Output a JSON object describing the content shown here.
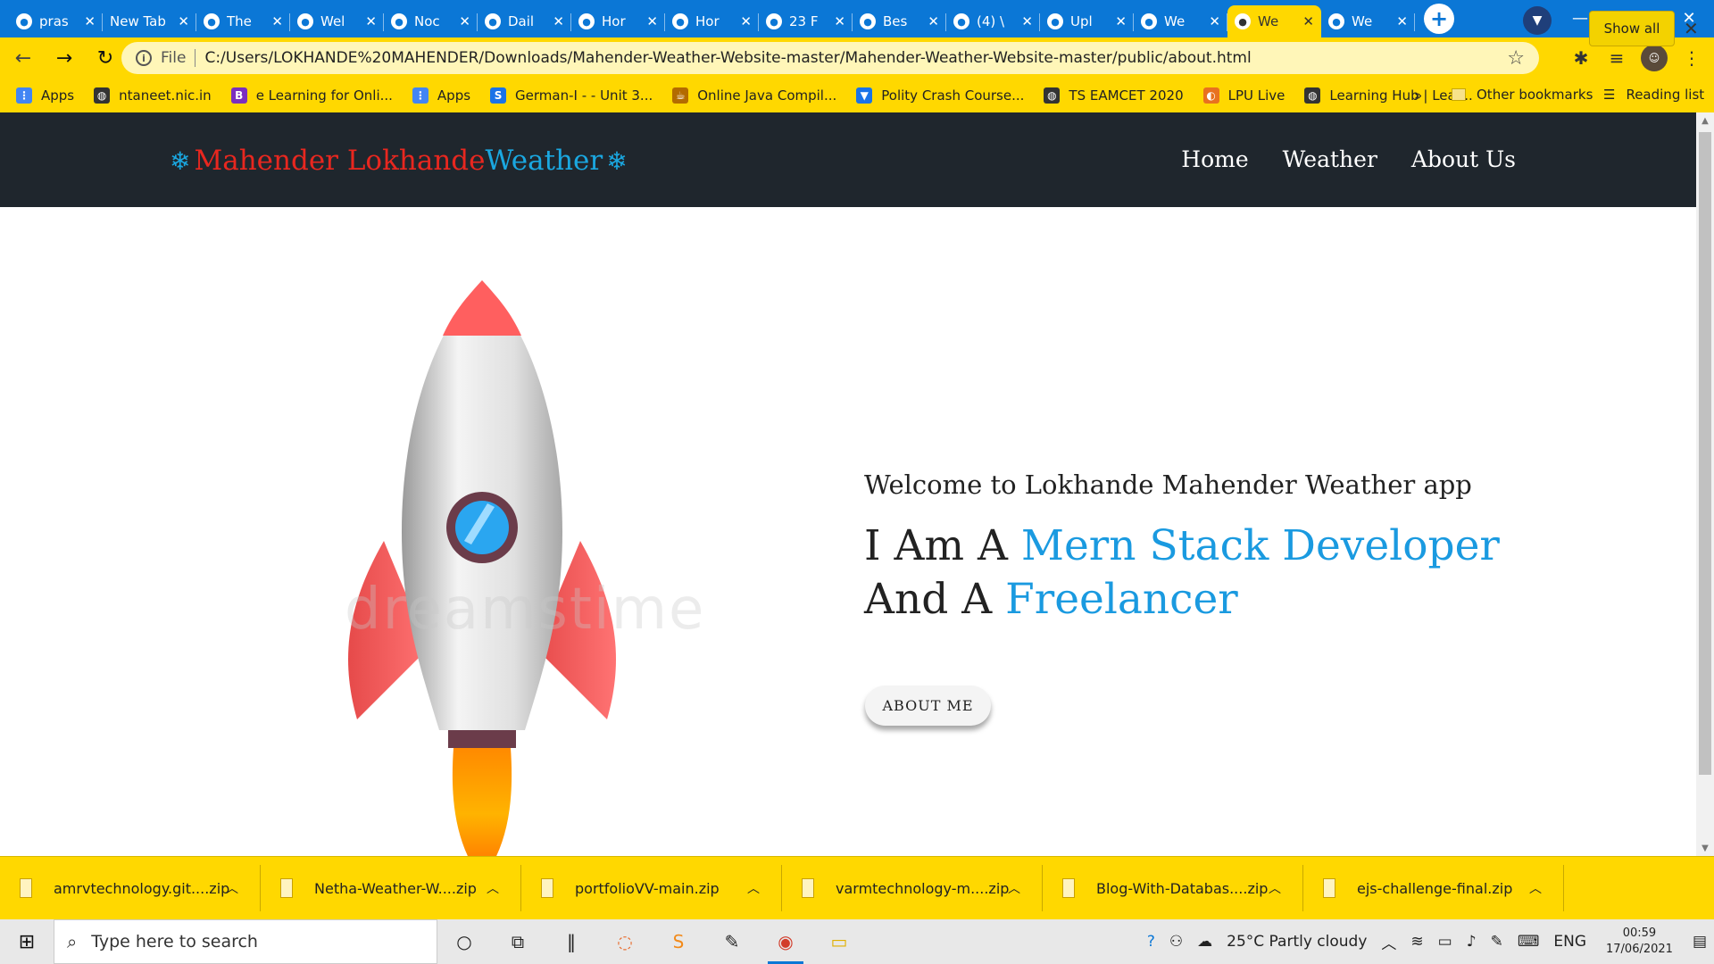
{
  "browser": {
    "tabs": [
      {
        "title": "pras",
        "icon": "github-icon"
      },
      {
        "title": "New Tab",
        "icon": ""
      },
      {
        "title": "The",
        "icon": "site-icon"
      },
      {
        "title": "Wel",
        "icon": "site-icon"
      },
      {
        "title": "Noc",
        "icon": "site-icon"
      },
      {
        "title": "Dail",
        "icon": "site-icon"
      },
      {
        "title": "Hor",
        "icon": "site-icon"
      },
      {
        "title": "Hor",
        "icon": "site-icon"
      },
      {
        "title": "23 F",
        "icon": "site-icon"
      },
      {
        "title": "Bes",
        "icon": "site-icon"
      },
      {
        "title": "(4) \\",
        "icon": "whatsapp-icon"
      },
      {
        "title": "Upl",
        "icon": "github-icon"
      },
      {
        "title": "We",
        "icon": "site-icon"
      },
      {
        "title": "We",
        "icon": "site-icon",
        "active": true
      },
      {
        "title": "We",
        "icon": "globe-icon"
      }
    ],
    "address": {
      "scheme": "File",
      "url": "C:/Users/LOKHANDE%20MAHENDER/Downloads/Mahender-Weather-Website-master/Mahender-Weather-Website-master/public/about.html"
    },
    "bookmarks": [
      {
        "label": "Apps",
        "icon": "apps-grid-icon"
      },
      {
        "label": "ntaneet.nic.in",
        "icon": "globe-icon"
      },
      {
        "label": "e Learning for Onli...",
        "icon": "bookmark-b-icon"
      },
      {
        "label": "Apps",
        "icon": "apps-grid-icon"
      },
      {
        "label": "German-I - - Unit 3...",
        "icon": "s-logo-icon"
      },
      {
        "label": "Online Java Compil...",
        "icon": "java-icon"
      },
      {
        "label": "Polity Crash Course...",
        "icon": "bookmark-icon"
      },
      {
        "label": "TS EAMCET 2020",
        "icon": "globe-icon"
      },
      {
        "label": "LPU Live",
        "icon": "lpu-icon"
      },
      {
        "label": "Learning Hub | Lear...",
        "icon": "globe-icon"
      }
    ],
    "bookmarks_more": "»",
    "other_bookmarks": "Other bookmarks",
    "reading_list": "Reading list"
  },
  "site": {
    "brand_part1": "Mahender Lokhande",
    "brand_part2": "Weather",
    "nav": [
      "Home",
      "Weather",
      "About Us"
    ],
    "welcome": "Welcome to Lokhande Mahender Weather app",
    "line1_prefix": "I Am A ",
    "line1_highlight": "Mern Stack Developer",
    "line2_prefix": "And A ",
    "line2_highlight": "Freelancer",
    "button": "ABOUT ME",
    "watermark": "dreamstime"
  },
  "downloads": {
    "items": [
      "amrvtechnology.git....zip",
      "Netha-Weather-W....zip",
      "portfolioVV-main.zip",
      "varmtechnology-m....zip",
      "Blog-With-Databas....zip",
      "ejs-challenge-final.zip"
    ],
    "show_all": "Show all"
  },
  "taskbar": {
    "search_placeholder": "Type here to search",
    "weather": "25°C  Partly cloudy",
    "lang": "ENG",
    "time": "00:59",
    "date": "17/06/2021"
  },
  "colors": {
    "tabstrip": "#0b77d6",
    "chrome_yellow": "#ffd800",
    "site_nav": "#1f262d",
    "accent_blue": "#1a9ae0",
    "brand_red": "#e8271f"
  }
}
